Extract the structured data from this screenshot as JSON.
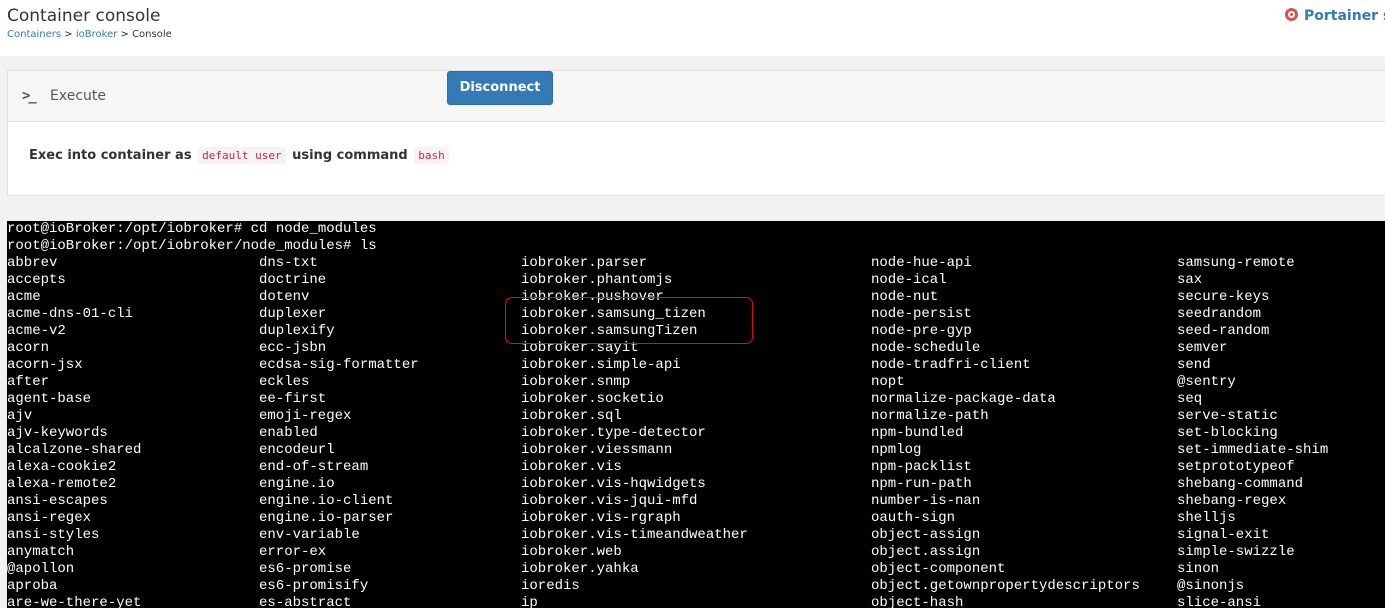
{
  "header": {
    "title": "Container console",
    "breadcrumb": {
      "items": [
        "Containers",
        "ioBroker",
        "Console"
      ],
      "separator": ">"
    },
    "support_link": "Portainer su",
    "support_icon": "lifebuoy-icon"
  },
  "panel": {
    "title": "Execute",
    "icon": "terminal-icon",
    "exec_prefix": "Exec into container as",
    "user_value": "default user",
    "exec_middle": "using command",
    "command_value": "bash",
    "button_label": "Disconnect",
    "accent_color": "#337ab7"
  },
  "terminal": {
    "prompt_lines": [
      "root@ioBroker:/opt/iobroker# cd node_modules",
      "root@ioBroker:/opt/iobroker/node_modules# ls"
    ],
    "columns": [
      [
        "abbrev",
        "accepts",
        "acme",
        "acme-dns-01-cli",
        "acme-v2",
        "acorn",
        "acorn-jsx",
        "after",
        "agent-base",
        "ajv",
        "ajv-keywords",
        "alcalzone-shared",
        "alexa-cookie2",
        "alexa-remote2",
        "ansi-escapes",
        "ansi-regex",
        "ansi-styles",
        "anymatch",
        "@apollon",
        "aproba",
        "are-we-there-yet"
      ],
      [
        "dns-txt",
        "doctrine",
        "dotenv",
        "duplexer",
        "duplexify",
        "ecc-jsbn",
        "ecdsa-sig-formatter",
        "eckles",
        "ee-first",
        "emoji-regex",
        "enabled",
        "encodeurl",
        "end-of-stream",
        "engine.io",
        "engine.io-client",
        "engine.io-parser",
        "env-variable",
        "error-ex",
        "es6-promise",
        "es6-promisify",
        "es-abstract"
      ],
      [
        "iobroker.parser",
        "iobroker.phantomjs",
        "iobroker.pushover",
        "iobroker.samsung_tizen",
        "iobroker.samsungTizen",
        "iobroker.sayit",
        "iobroker.simple-api",
        "iobroker.snmp",
        "iobroker.socketio",
        "iobroker.sql",
        "iobroker.type-detector",
        "iobroker.viessmann",
        "iobroker.vis",
        "iobroker.vis-hqwidgets",
        "iobroker.vis-jqui-mfd",
        "iobroker.vis-rgraph",
        "iobroker.vis-timeandweather",
        "iobroker.web",
        "iobroker.yahka",
        "ioredis",
        "ip"
      ],
      [
        "node-hue-api",
        "node-ical",
        "node-nut",
        "node-persist",
        "node-pre-gyp",
        "node-schedule",
        "node-tradfri-client",
        "nopt",
        "normalize-package-data",
        "normalize-path",
        "npm-bundled",
        "npmlog",
        "npm-packlist",
        "npm-run-path",
        "number-is-nan",
        "oauth-sign",
        "object-assign",
        "object.assign",
        "object-component",
        "object.getownpropertydescriptors",
        "object-hash"
      ],
      [
        "samsung-remote",
        "sax",
        "secure-keys",
        "seedrandom",
        "seed-random",
        "semver",
        "send",
        "@sentry",
        "seq",
        "serve-static",
        "set-blocking",
        "set-immediate-shim",
        "setprototypeof",
        "shebang-command",
        "shebang-regex",
        "shelljs",
        "signal-exit",
        "simple-swizzle",
        "sinon",
        "@sinonjs",
        "slice-ansi"
      ]
    ],
    "highlight_color": "#e01010"
  }
}
